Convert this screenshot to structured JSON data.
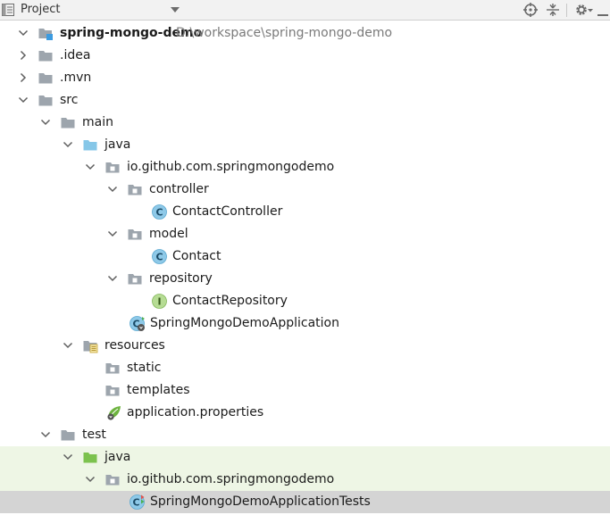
{
  "panel": {
    "title": "Project"
  },
  "tree": {
    "root": {
      "name": "spring-mongo-demo",
      "path": "D:\\workspace\\spring-mongo-demo"
    },
    "idea": ".idea",
    "mvn": ".mvn",
    "src": "src",
    "main": "main",
    "main_java": "java",
    "main_pkg": "io.github.com.springmongodemo",
    "controller": "controller",
    "contact_controller": "ContactController",
    "model": "model",
    "contact": "Contact",
    "repository": "repository",
    "contact_repository": "ContactRepository",
    "app_class": "SpringMongoDemoApplication",
    "resources": "resources",
    "static": "static",
    "templates": "templates",
    "app_props": "application.properties",
    "test": "test",
    "test_java": "java",
    "test_pkg": "io.github.com.springmongodemo",
    "test_class": "SpringMongoDemoApplicationTests"
  }
}
